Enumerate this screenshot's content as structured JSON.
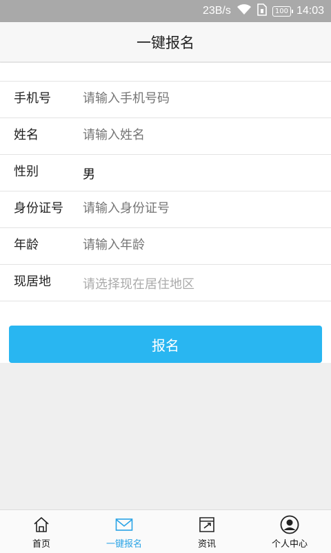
{
  "status_bar": {
    "speed": "23B/s",
    "battery": "100",
    "time": "14:03"
  },
  "header": {
    "title": "一键报名"
  },
  "form": {
    "rows": [
      {
        "label": "手机号",
        "placeholder": "请输入手机号码",
        "value": ""
      },
      {
        "label": "姓名",
        "placeholder": "请输入姓名",
        "value": ""
      },
      {
        "label": "性别",
        "placeholder": "",
        "value": "男"
      },
      {
        "label": "身份证号",
        "placeholder": "请输入身份证号",
        "value": ""
      },
      {
        "label": "年龄",
        "placeholder": "请输入年龄",
        "value": ""
      },
      {
        "label": "现居地",
        "placeholder": "请选择现在居住地区",
        "value": ""
      }
    ],
    "submit_label": "报名"
  },
  "tabs": [
    {
      "label": "首页",
      "icon": "home-icon"
    },
    {
      "label": "一键报名",
      "icon": "mail-icon",
      "active": true
    },
    {
      "label": "资讯",
      "icon": "news-icon"
    },
    {
      "label": "个人中心",
      "icon": "user-icon"
    }
  ],
  "colors": {
    "accent": "#29b6f1",
    "active_tab": "#29a3e6",
    "status_bar": "#a9a9a9"
  }
}
